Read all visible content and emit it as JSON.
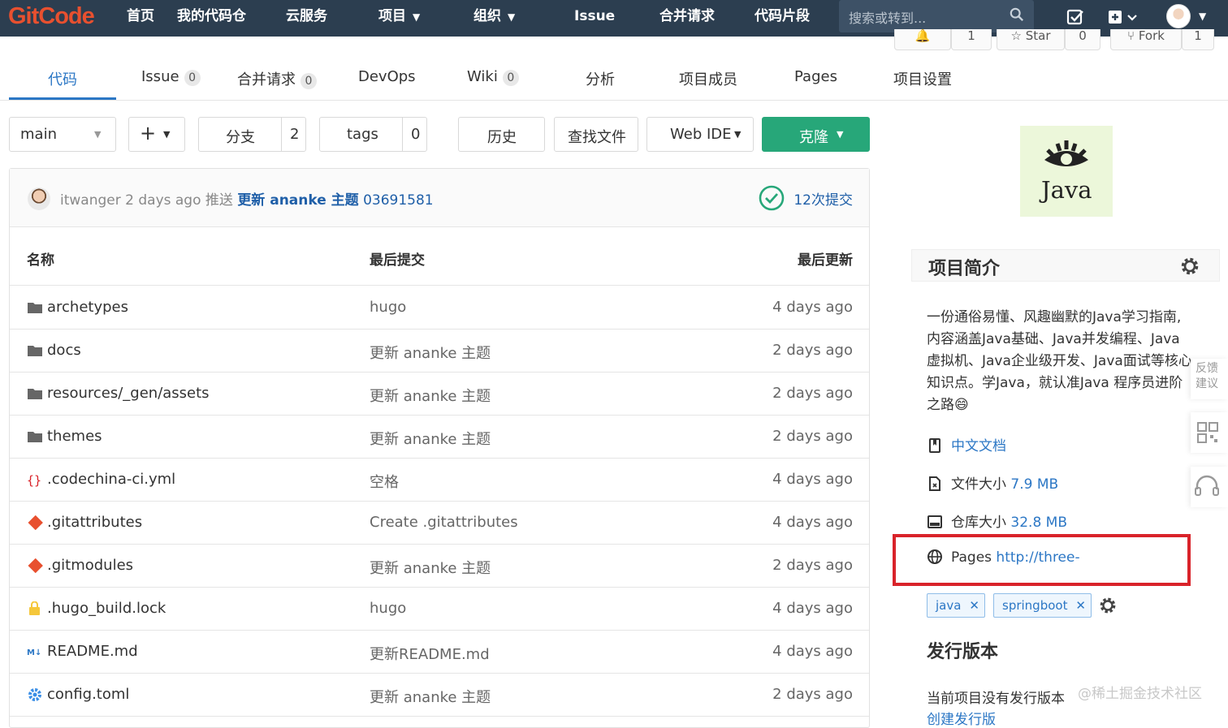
{
  "brand": {
    "logo_text": "GitCode",
    "accent": "#e8502f",
    "link_color": "#2c77c5",
    "clone_color": "#27a779"
  },
  "topnav": {
    "items": [
      {
        "label": "首页"
      },
      {
        "label": "我的代码仓"
      },
      {
        "label": "云服务"
      },
      {
        "label": "项目"
      },
      {
        "label": "组织"
      },
      {
        "label": "Issue"
      },
      {
        "label": "合并请求"
      },
      {
        "label": "代码片段"
      }
    ],
    "search_placeholder": "搜索或转到..."
  },
  "peek_buttons": {
    "notify_count": "1",
    "star_label": "Star",
    "star_count": "0",
    "fork_label": "Fork",
    "fork_count": "1"
  },
  "tabs": [
    {
      "label": "代码"
    },
    {
      "label": "Issue",
      "count": "0"
    },
    {
      "label": "合并请求",
      "count": "0"
    },
    {
      "label": "DevOps"
    },
    {
      "label": "Wiki",
      "count": "0"
    },
    {
      "label": "分析"
    },
    {
      "label": "项目成员"
    },
    {
      "label": "Pages"
    },
    {
      "label": "项目设置"
    }
  ],
  "controls": {
    "branch": "main",
    "add": "+",
    "branches_label": "分支",
    "branches_count": "2",
    "tags_label": "tags",
    "tags_count": "0",
    "history": "历史",
    "find_file": "查找文件",
    "web_ide": "Web IDE",
    "clone": "克隆"
  },
  "commit": {
    "author": "itwanger",
    "time": "2 days ago",
    "action": "推送",
    "message": "更新 ananke 主题",
    "sha": "03691581",
    "commit_count": "12次提交"
  },
  "table": {
    "headers": {
      "name": "名称",
      "last_commit": "最后提交",
      "last_update": "最后更新"
    },
    "rows": [
      {
        "icon": "folder-icon",
        "name": "archetypes",
        "message": "hugo",
        "time": "4 days ago"
      },
      {
        "icon": "folder-icon",
        "name": "docs",
        "message": "更新 ananke 主题",
        "time": "2 days ago"
      },
      {
        "icon": "folder-icon",
        "name": "resources/_gen/assets",
        "message": "更新 ananke 主题",
        "time": "2 days ago"
      },
      {
        "icon": "folder-icon",
        "name": "themes",
        "message": "更新 ananke 主题",
        "time": "2 days ago"
      },
      {
        "icon": "yaml-icon",
        "name": ".codechina-ci.yml",
        "message": "空格",
        "time": "4 days ago"
      },
      {
        "icon": "git-icon",
        "name": ".gitattributes",
        "message": "Create .gitattributes",
        "time": "4 days ago"
      },
      {
        "icon": "git-icon",
        "name": ".gitmodules",
        "message": "更新 ananke 主题",
        "time": "2 days ago"
      },
      {
        "icon": "lock-icon",
        "name": ".hugo_build.lock",
        "message": "hugo",
        "time": "4 days ago"
      },
      {
        "icon": "markdown-icon",
        "name": "README.md",
        "message": "更新README.md",
        "time": "4 days ago"
      },
      {
        "icon": "gear-icon",
        "name": "config.toml",
        "message": "更新 ananke 主题",
        "time": "2 days ago"
      }
    ]
  },
  "sidebar": {
    "logo_text": "Java",
    "intro_title": "项目简介",
    "description_lines": [
      "一份通俗易懂、风趣幽默的Java学习指南,",
      "内容涵盖Java基础、Java并发编程、Java",
      "虚拟机、Java企业级开发、Java面试等核心",
      "知识点。学Java，就认准Java 程序员进阶",
      "之路😄"
    ],
    "docs_link": "中文文档",
    "file_size_label": "文件大小",
    "file_size": "7.9 MB",
    "repo_size_label": "仓库大小",
    "repo_size": "32.8 MB",
    "pages_label": "Pages",
    "pages_url": "http://three-",
    "tags": [
      "java",
      "springboot"
    ],
    "release_title": "发行版本",
    "release_text": "当前项目没有发行版本",
    "release_link": "创建发行版",
    "feedback": "反馈建议",
    "watermark": "@稀土掘金技术社区"
  }
}
